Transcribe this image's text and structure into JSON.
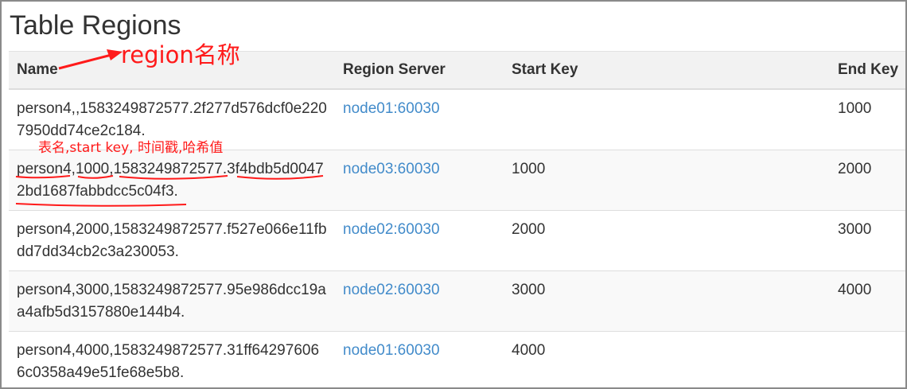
{
  "page": {
    "title": "Table Regions"
  },
  "annotations": {
    "region_name": "region名称",
    "name_fields": "表名,start key, 时间戳,哈希值"
  },
  "table": {
    "columns": [
      "Name",
      "Region Server",
      "Start Key",
      "End Key"
    ],
    "rows": [
      {
        "name": "person4,,1583249872577.2f277d576dcf0e2207950dd74ce2c184.",
        "server": "node01:60030",
        "start_key": "",
        "end_key": "1000"
      },
      {
        "name": "person4,1000,1583249872577.3f4bdb5d00472bd1687fabbdcc5c04f3.",
        "server": "node03:60030",
        "start_key": "1000",
        "end_key": "2000"
      },
      {
        "name": "person4,2000,1583249872577.f527e066e11fbdd7dd34cb2c3a230053.",
        "server": "node02:60030",
        "start_key": "2000",
        "end_key": "3000"
      },
      {
        "name": "person4,3000,1583249872577.95e986dcc19aa4afb5d3157880e144b4.",
        "server": "node02:60030",
        "start_key": "3000",
        "end_key": "4000"
      },
      {
        "name": "person4,4000,1583249872577.31ff642976066c0358a49e51fe68e5b8.",
        "server": "node01:60030",
        "start_key": "4000",
        "end_key": ""
      }
    ]
  },
  "colors": {
    "annotation": "#ff1a1a",
    "link": "#428bca",
    "header_bg": "#f2f2f2",
    "stripe_bg": "#f9f9f9"
  }
}
